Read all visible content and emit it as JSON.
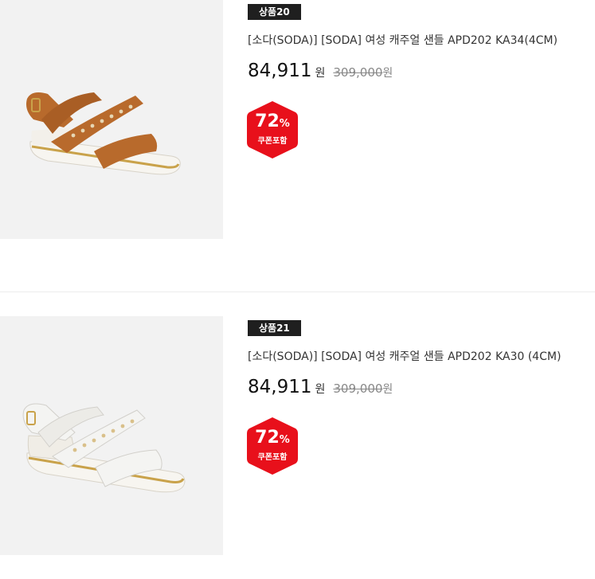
{
  "products": [
    {
      "badge": "상품20",
      "title": "[소다(SODA)] [SODA] 여성 캐주얼 샌들 APD202 KA34(4CM)",
      "price": "84,911",
      "price_unit": "원",
      "original_price": "309,000",
      "original_unit": "원",
      "discount_number": "72",
      "discount_symbol": "%",
      "discount_label": "쿠폰포함",
      "strap_color": "#b86a2c",
      "image_icon": "sandal-image"
    },
    {
      "badge": "상품21",
      "title": "[소다(SODA)] [SODA] 여성 캐주얼 샌들 APD202 KA30 (4CM)",
      "price": "84,911",
      "price_unit": "원",
      "original_price": "309,000",
      "original_unit": "원",
      "discount_number": "72",
      "discount_symbol": "%",
      "discount_label": "쿠폰포함",
      "strap_color": "#f4f4f2",
      "image_icon": "sandal-image"
    }
  ],
  "colors": {
    "badge_bg": "#1f1f1f",
    "discount_red": "#e8101b",
    "image_bg": "#f2f2f2",
    "gold_trim": "#c9a24a"
  }
}
